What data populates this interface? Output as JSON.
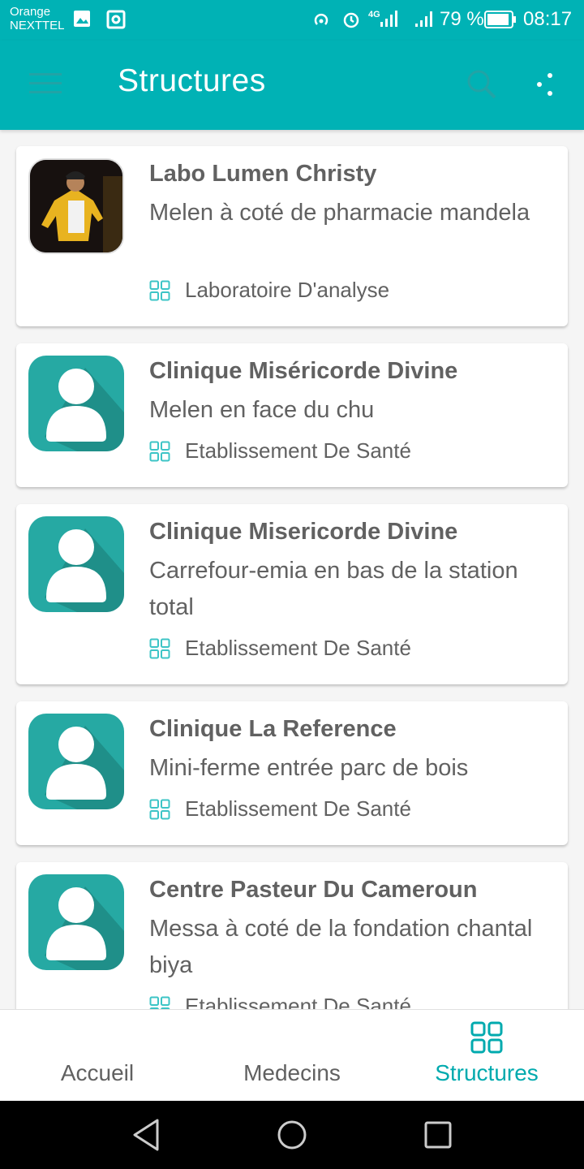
{
  "status_bar": {
    "carrier_line1": "Orange",
    "carrier_line2": "NEXTTEL",
    "network": "4G",
    "battery": "79 %",
    "time": "08:17"
  },
  "app_bar": {
    "title": "Structures",
    "icons": [
      "menu-icon",
      "search-icon",
      "share-icon"
    ]
  },
  "structures": [
    {
      "name": "Labo Lumen Christy",
      "address": "Melen à coté de pharmacie mandela",
      "category": "Laboratoire D'analyse",
      "avatar": "photo"
    },
    {
      "name": "Clinique Miséricorde Divine",
      "address": "Melen en face du chu",
      "category": "Etablissement De Santé",
      "avatar": "person-icon"
    },
    {
      "name": "Clinique Misericorde Divine",
      "address": "Carrefour-emia en bas de la station total",
      "category": "Etablissement De Santé",
      "avatar": "person-icon"
    },
    {
      "name": "Clinique La Reference",
      "address": "Mini-ferme entrée parc de bois",
      "category": "Etablissement De Santé",
      "avatar": "person-icon"
    },
    {
      "name": "Centre Pasteur Du Cameroun",
      "address": "Messa à coté de la fondation chantal biya",
      "category": "Etablissement De Santé",
      "avatar": "person-icon"
    }
  ],
  "bottom_nav": {
    "items": [
      {
        "label": "Accueil",
        "active": false
      },
      {
        "label": "Medecins",
        "active": false
      },
      {
        "label": "Structures",
        "active": true,
        "icon": "grid-icon"
      }
    ]
  },
  "colors": {
    "primary": "#00b2b5",
    "accent": "#00aaae",
    "avatar_bg": "#26a9a3",
    "text": "#616161"
  }
}
